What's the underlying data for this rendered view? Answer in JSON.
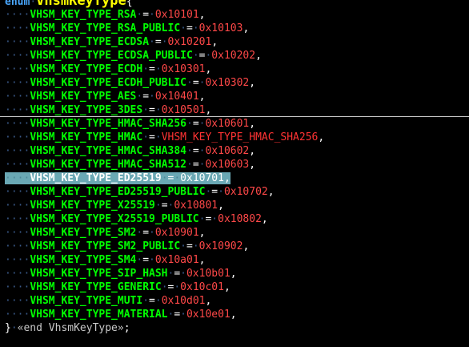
{
  "header": {
    "keyword": "enum",
    "type_name": "VhsmKeyType",
    "open_brace": "{"
  },
  "entries": [
    {
      "name": "VHSM_KEY_TYPE_RSA",
      "value": "0x10101"
    },
    {
      "name": "VHSM_KEY_TYPE_RSA_PUBLIC",
      "value": "0x10103"
    },
    {
      "name": "VHSM_KEY_TYPE_ECDSA",
      "value": "0x10201"
    },
    {
      "name": "VHSM_KEY_TYPE_ECDSA_PUBLIC",
      "value": "0x10202"
    },
    {
      "name": "VHSM_KEY_TYPE_ECDH",
      "value": "0x10301"
    },
    {
      "name": "VHSM_KEY_TYPE_ECDH_PUBLIC",
      "value": "0x10302"
    },
    {
      "name": "VHSM_KEY_TYPE_AES",
      "value": "0x10401"
    },
    {
      "name": "VHSM_KEY_TYPE_3DES",
      "value": "0x10501"
    },
    {
      "name": "VHSM_KEY_TYPE_HMAC_SHA256",
      "value": "0x10601"
    },
    {
      "name": "VHSM_KEY_TYPE_HMAC",
      "value": "VHSM_KEY_TYPE_HMAC_SHA256"
    },
    {
      "name": "VHSM_KEY_TYPE_HMAC_SHA384",
      "value": "0x10602"
    },
    {
      "name": "VHSM_KEY_TYPE_HMAC_SHA512",
      "value": "0x10603"
    },
    {
      "name": "VHSM_KEY_TYPE_ED25519",
      "value": "0x10701"
    },
    {
      "name": "VHSM_KEY_TYPE_ED25519_PUBLIC",
      "value": "0x10702"
    },
    {
      "name": "VHSM_KEY_TYPE_X25519",
      "value": "0x10801"
    },
    {
      "name": "VHSM_KEY_TYPE_X25519_PUBLIC",
      "value": "0x10802"
    },
    {
      "name": "VHSM_KEY_TYPE_SM2",
      "value": "0x10901"
    },
    {
      "name": "VHSM_KEY_TYPE_SM2_PUBLIC",
      "value": "0x10902"
    },
    {
      "name": "VHSM_KEY_TYPE_SM4",
      "value": "0x10a01"
    },
    {
      "name": "VHSM_KEY_TYPE_SIP_HASH",
      "value": "0x10b01"
    },
    {
      "name": "VHSM_KEY_TYPE_GENERIC",
      "value": "0x10c01"
    },
    {
      "name": "VHSM_KEY_TYPE_MUTI",
      "value": "0x10d01"
    },
    {
      "name": "VHSM_KEY_TYPE_MATERIAL",
      "value": "0x10e01"
    }
  ],
  "selected_entry": "VHSM_KEY_TYPE_ED25519",
  "footer": {
    "close_brace": "}",
    "comment": "«end VhsmKeyType»",
    "semicolon": ";"
  },
  "colors": {
    "background": "#000000",
    "identifier": "#00ff00",
    "number": "#ff4848",
    "keyword": "#4aa8ff",
    "type_name": "#ffff00",
    "selection": "#6aa8b4"
  }
}
